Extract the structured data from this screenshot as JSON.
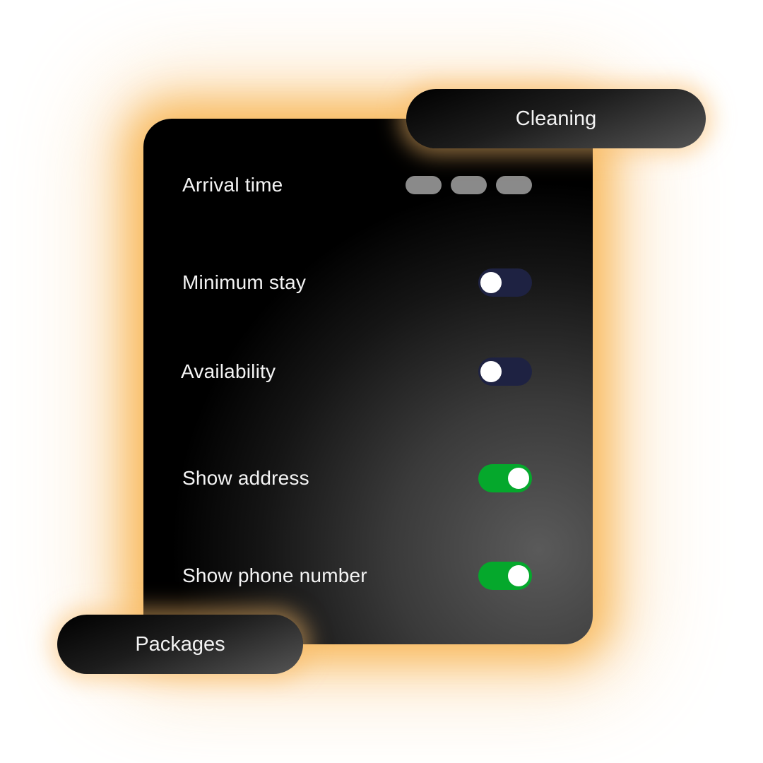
{
  "chips": {
    "top": "Cleaning",
    "bottom": "Packages"
  },
  "settings": [
    {
      "label": "Arrival time",
      "control": "time-slots",
      "slots": 3
    },
    {
      "label": "Minimum stay",
      "control": "toggle",
      "on": false
    },
    {
      "label": "Availability",
      "control": "toggle",
      "on": false
    },
    {
      "label": "Show address",
      "control": "toggle",
      "on": true
    },
    {
      "label": "Show phone number",
      "control": "toggle",
      "on": true
    }
  ],
  "colors": {
    "toggle_on": "#05a82c",
    "toggle_off": "#1e2242",
    "glow": "#f7b046",
    "slot": "#8a8a8a"
  }
}
